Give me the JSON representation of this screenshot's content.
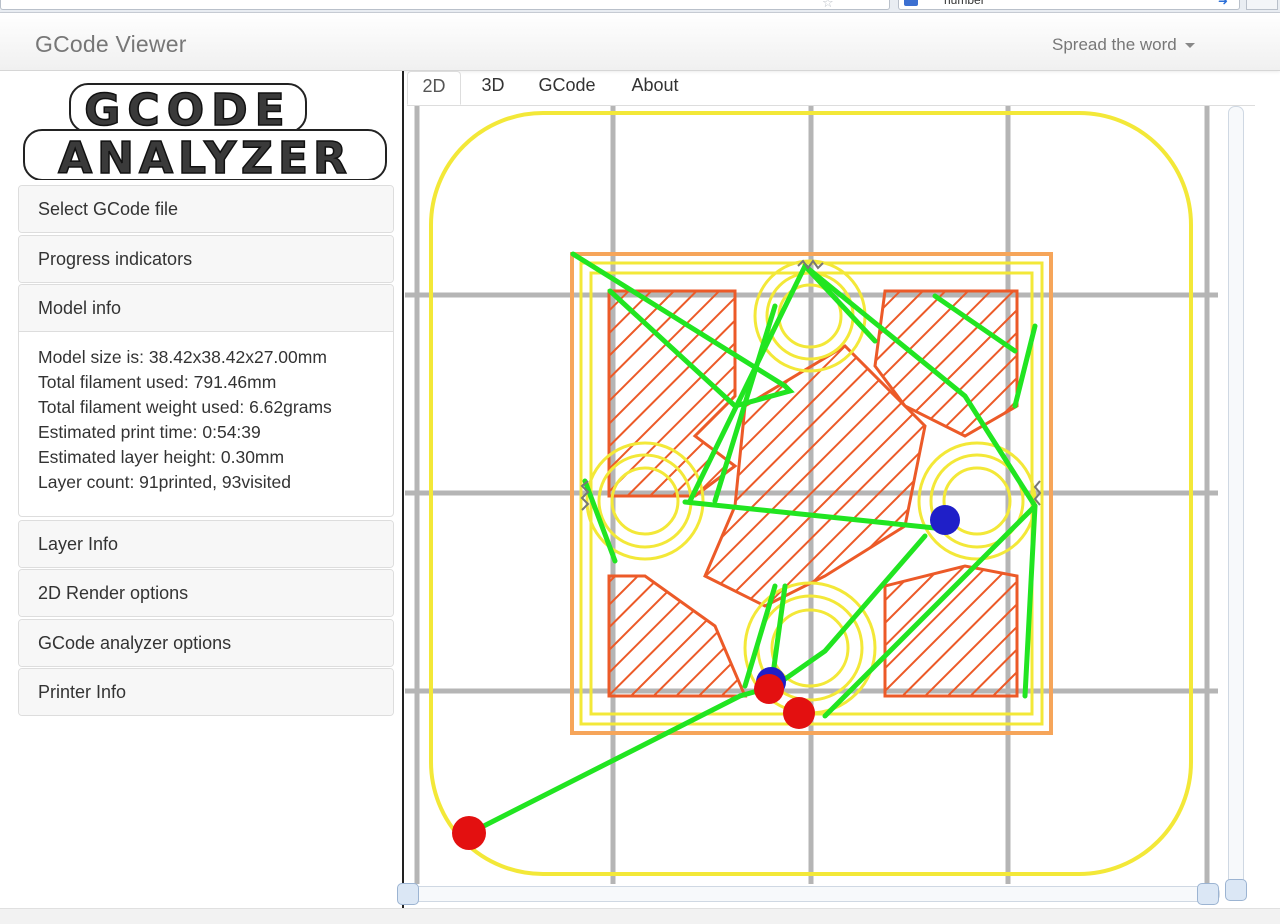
{
  "browser": {
    "search_text": "number"
  },
  "navbar": {
    "brand": "GCode Viewer",
    "spread_label": "Spread the word"
  },
  "logo": {
    "line1": "GCODE",
    "line2": "ANALYZER"
  },
  "sidebar": {
    "panels": [
      {
        "label": "Select GCode file"
      },
      {
        "label": "Progress indicators"
      },
      {
        "label": "Model info"
      },
      {
        "label": "Layer Info"
      },
      {
        "label": "2D Render options"
      },
      {
        "label": "GCode analyzer options"
      },
      {
        "label": "Printer Info"
      }
    ],
    "model_info": {
      "lines": [
        "Model size is: 38.42x38.42x27.00mm",
        "Total filament used: 791.46mm",
        "Total filament weight used: 6.62grams",
        "Estimated print time: 0:54:39",
        "Estimated layer height: 0.30mm",
        "Layer count: 91printed, 93visited"
      ]
    }
  },
  "tabs": [
    {
      "label": "2D"
    },
    {
      "label": "3D"
    },
    {
      "label": "GCode"
    },
    {
      "label": "About"
    }
  ],
  "colors": {
    "grid": "#b5b5b5",
    "perimeter": "#f3e838",
    "skirt_outer": "#f6a55a",
    "infill": "#ec5a28",
    "travel": "#21e521",
    "retract": "#e31010",
    "restart": "#1f1fc8"
  },
  "icons": {
    "star": "star-icon",
    "search": "search-engine-icon",
    "dropdown": "caret-down-icon"
  }
}
